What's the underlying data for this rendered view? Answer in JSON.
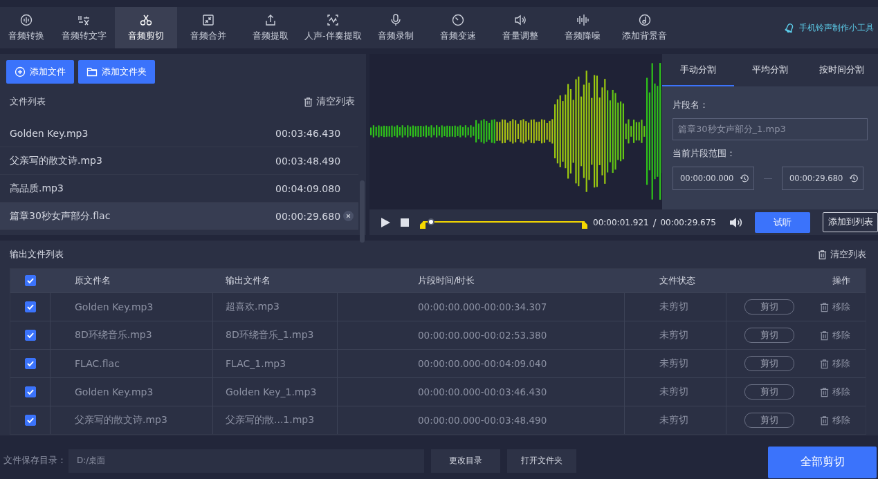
{
  "toolbar": {
    "items": [
      {
        "label": "音频转换",
        "selected": false
      },
      {
        "label": "音频转文字",
        "selected": false
      },
      {
        "label": "音频剪切",
        "selected": true
      },
      {
        "label": "音频合并",
        "selected": false
      },
      {
        "label": "音频提取",
        "selected": false
      },
      {
        "label": "人声-伴奏提取",
        "selected": false
      },
      {
        "label": "音频录制",
        "selected": false
      },
      {
        "label": "音频变速",
        "selected": false
      },
      {
        "label": "音量调整",
        "selected": false
      },
      {
        "label": "音频降噪",
        "selected": false
      },
      {
        "label": "添加背景音",
        "selected": false
      }
    ],
    "link": "手机铃声制作小工具"
  },
  "files": {
    "add_file": "添加文件",
    "add_folder": "添加文件夹",
    "title": "文件列表",
    "clear": "清空列表",
    "rows": [
      {
        "name": "Golden Key.mp3",
        "duration": "00:03:46.430",
        "selected": false
      },
      {
        "name": "父亲写的散文诗.mp3",
        "duration": "00:03:48.490",
        "selected": false
      },
      {
        "name": "高品质.mp3",
        "duration": "00:04:09.080",
        "selected": false
      },
      {
        "name": "篇章30秒女声部分.flac",
        "duration": "00:00:29.680",
        "selected": true
      }
    ]
  },
  "split": {
    "tabs": [
      {
        "label": "手动分割",
        "selected": true
      },
      {
        "label": "平均分割",
        "selected": false
      },
      {
        "label": "按时间分割",
        "selected": false
      }
    ],
    "name_label": "片段名：",
    "name_value": "篇章30秒女声部分_1.mp3",
    "range_label": "当前片段范围：",
    "start": "00:00:00.000",
    "end": "00:00:29.680"
  },
  "player": {
    "level": 0.065,
    "current": "00:00:01.921",
    "separator": "/",
    "total": "00:00:29.675",
    "preview": "试听",
    "add_to_list": "添加到列表"
  },
  "output": {
    "title": "输出文件列表",
    "clear": "清空列表",
    "all_checked": true,
    "columns": [
      "原文件名",
      "输出文件名",
      "片段时间/时长",
      "文件状态",
      "操作"
    ],
    "rows": [
      {
        "checked": true,
        "source": "Golden Key.mp3",
        "output": "超喜欢.mp3",
        "segment": "00:00:00.000-00:00:34.307",
        "status": "未剪切",
        "cut": "剪切",
        "remove": "移除"
      },
      {
        "checked": true,
        "source": "8D环绕音乐.mp3",
        "output": "8D环绕音乐_1.mp3",
        "segment": "00:00:00.000-00:02:53.380",
        "status": "未剪切",
        "cut": "剪切",
        "remove": "移除"
      },
      {
        "checked": true,
        "source": "FLAC.flac",
        "output": "FLAC_1.mp3",
        "segment": "00:00:00.000-00:04:09.040",
        "status": "未剪切",
        "cut": "剪切",
        "remove": "移除"
      },
      {
        "checked": true,
        "source": "Golden Key.mp3",
        "output": "Golden Key_1.mp3",
        "segment": "00:00:00.000-00:03:46.430",
        "status": "未剪切",
        "cut": "剪切",
        "remove": "移除"
      },
      {
        "checked": true,
        "source": "父亲写的散文诗.mp3",
        "output": "父亲写的散...1.mp3",
        "segment": "00:00:00.000-00:03:48.490",
        "status": "未剪切",
        "cut": "剪切",
        "remove": "移除"
      }
    ]
  },
  "footer": {
    "label": "文件保存目录：",
    "path": "D:/桌面",
    "change": "更改目录",
    "open": "打开文件夹",
    "cut_all": "全部剪切"
  }
}
